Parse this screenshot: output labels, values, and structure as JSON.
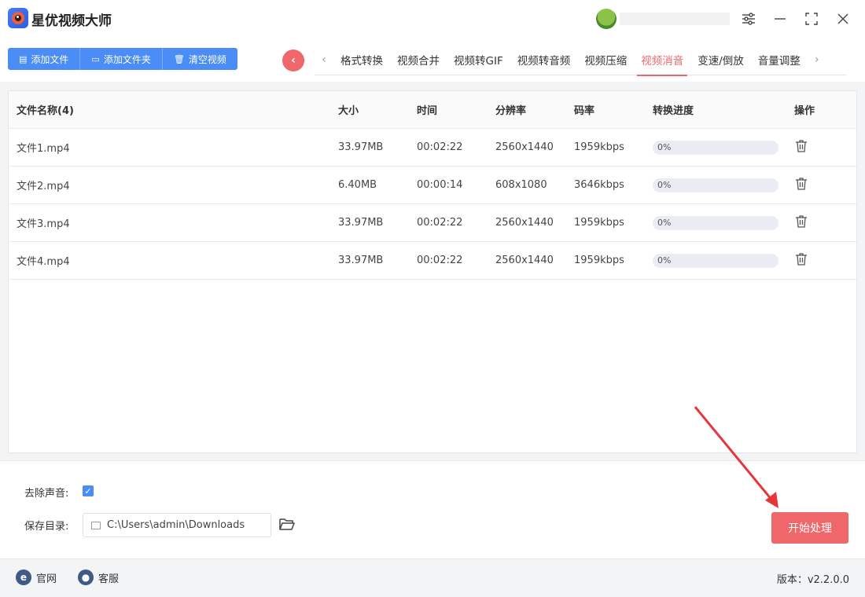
{
  "app": {
    "title": "星优视频大师"
  },
  "toolbar": {
    "add_file": "添加文件",
    "add_folder": "添加文件夹",
    "clear": "清空视频"
  },
  "tabs": [
    {
      "label": "格式转换"
    },
    {
      "label": "视频合并"
    },
    {
      "label": "视频转GIF"
    },
    {
      "label": "视频转音频"
    },
    {
      "label": "视频压缩"
    },
    {
      "label": "视频消音",
      "active": true
    },
    {
      "label": "变速/倒放"
    },
    {
      "label": "音量调整"
    }
  ],
  "table": {
    "headers": {
      "name": "文件名称(4)",
      "size": "大小",
      "time": "时间",
      "resolution": "分辨率",
      "bitrate": "码率",
      "progress": "转换进度",
      "action": "操作"
    },
    "rows": [
      {
        "name": "文件1.mp4",
        "size": "33.97MB",
        "time": "00:02:22",
        "resolution": "2560x1440",
        "bitrate": "1959kbps",
        "progress": "0%"
      },
      {
        "name": "文件2.mp4",
        "size": "6.40MB",
        "time": "00:00:14",
        "resolution": "608x1080",
        "bitrate": "3646kbps",
        "progress": "0%"
      },
      {
        "name": "文件3.mp4",
        "size": "33.97MB",
        "time": "00:02:22",
        "resolution": "2560x1440",
        "bitrate": "1959kbps",
        "progress": "0%"
      },
      {
        "name": "文件4.mp4",
        "size": "33.97MB",
        "time": "00:02:22",
        "resolution": "2560x1440",
        "bitrate": "1959kbps",
        "progress": "0%"
      }
    ]
  },
  "settings": {
    "remove_audio_label": "去除声音:",
    "remove_audio_checked": true,
    "save_dir_label": "保存目录:",
    "save_dir_value": "C:\\Users\\admin\\Downloads",
    "start_button": "开始处理"
  },
  "footer": {
    "website": "官网",
    "support": "客服",
    "version": "版本：v2.2.0.0"
  },
  "colors": {
    "accent_blue": "#4a8df6",
    "accent_red": "#f0676b"
  }
}
